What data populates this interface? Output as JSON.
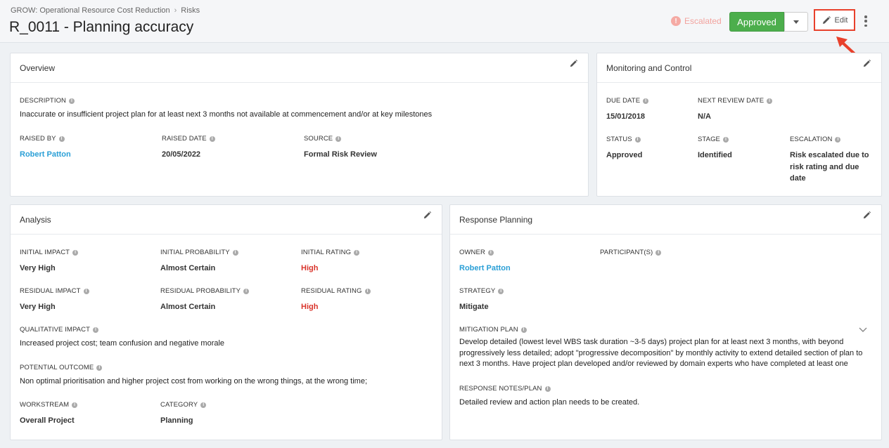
{
  "breadcrumb": {
    "parent": "GROW: Operational Resource Cost Reduction",
    "separator": "›",
    "current": "Risks"
  },
  "title": "R_0011 - Planning accuracy",
  "header": {
    "escalated_icon": "!",
    "escalated_label": "Escalated",
    "approved_label": "Approved",
    "edit_label": "Edit"
  },
  "overview": {
    "title": "Overview",
    "description_label": "DESCRIPTION",
    "description": "Inaccurate or insufficient project plan for at least next 3 months not available at commencement and/or at key milestones",
    "raised_by_label": "RAISED BY",
    "raised_by": "Robert Patton",
    "raised_date_label": "RAISED DATE",
    "raised_date": "20/05/2022",
    "source_label": "SOURCE",
    "source": "Formal Risk Review"
  },
  "monitoring": {
    "title": "Monitoring and Control",
    "due_date_label": "DUE DATE",
    "due_date": "15/01/2018",
    "next_review_label": "NEXT REVIEW DATE",
    "next_review": "N/A",
    "status_label": "STATUS",
    "status": "Approved",
    "stage_label": "STAGE",
    "stage": "Identified",
    "escalation_label": "ESCALATION",
    "escalation": "Risk escalated due to risk rating and due date"
  },
  "analysis": {
    "title": "Analysis",
    "initial_impact_label": "INITIAL IMPACT",
    "initial_impact": "Very High",
    "initial_probability_label": "INITIAL PROBABILITY",
    "initial_probability": "Almost Certain",
    "initial_rating_label": "INITIAL RATING",
    "initial_rating": "High",
    "residual_impact_label": "RESIDUAL IMPACT",
    "residual_impact": "Very High",
    "residual_probability_label": "RESIDUAL PROBABILITY",
    "residual_probability": "Almost Certain",
    "residual_rating_label": "RESIDUAL RATING",
    "residual_rating": "High",
    "qualitative_impact_label": "QUALITATIVE IMPACT",
    "qualitative_impact": "Increased project cost; team confusion and negative morale",
    "potential_outcome_label": "POTENTIAL OUTCOME",
    "potential_outcome": "Non optimal prioritisation and higher project cost from working on the wrong things, at the wrong time;",
    "workstream_label": "WORKSTREAM",
    "workstream": "Overall Project",
    "category_label": "CATEGORY",
    "category": "Planning"
  },
  "response": {
    "title": "Response Planning",
    "owner_label": "OWNER",
    "owner": "Robert Patton",
    "participants_label": "PARTICIPANT(S)",
    "strategy_label": "STRATEGY",
    "strategy": "Mitigate",
    "mitigation_label": "MITIGATION PLAN",
    "mitigation_line1": "Develop detailed (lowest level WBS task duration ~3-5 days) project plan for at least next 3 months, with beyond",
    "mitigation_line2": "progressively less detailed; adopt \"progressive decomposition\" by monthly activity to extend detailed section of plan to",
    "mitigation_line3": "next 3 months. Have project plan developed and/or reviewed by domain experts who have completed at least one",
    "notes_label": "RESPONSE NOTES/PLAN",
    "notes": "Detailed review and action plan needs to be created."
  },
  "colors": {
    "approved": "#4cae4c",
    "link": "#2a9fd6",
    "high": "#d9342b",
    "highlight": "#e8412c"
  }
}
